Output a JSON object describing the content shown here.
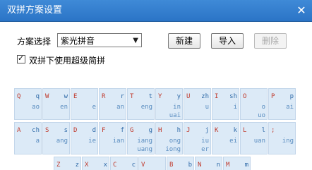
{
  "window": {
    "title": "双拼方案设置",
    "close": "✕"
  },
  "scheme_label": "方案选择",
  "scheme_value": "紫光拼音",
  "buttons": {
    "new": "新建",
    "import": "导入",
    "delete": "删除"
  },
  "checkbox": {
    "label": "双拼下使用超级简拼",
    "checked": true,
    "mark": "✓"
  },
  "keyboard": {
    "row1": [
      {
        "letter": "Q",
        "top": "q",
        "bottom": "ao"
      },
      {
        "letter": "W",
        "top": "w",
        "bottom": "en"
      },
      {
        "letter": "E",
        "top": "",
        "bottom": "e"
      },
      {
        "letter": "R",
        "top": "r",
        "bottom": "an"
      },
      {
        "letter": "T",
        "top": "t",
        "bottom": "eng"
      },
      {
        "letter": "Y",
        "top": "y",
        "bottom": "in\nuai"
      },
      {
        "letter": "U",
        "top": "zh",
        "bottom": "u"
      },
      {
        "letter": "I",
        "top": "sh",
        "bottom": "i"
      },
      {
        "letter": "O",
        "top": "",
        "bottom": "o\nuo"
      },
      {
        "letter": "P",
        "top": "p",
        "bottom": "ai"
      }
    ],
    "row2": [
      {
        "letter": "A",
        "top": "ch",
        "bottom": "a"
      },
      {
        "letter": "S",
        "top": "s",
        "bottom": "ang"
      },
      {
        "letter": "D",
        "top": "d",
        "bottom": "ie"
      },
      {
        "letter": "F",
        "top": "f",
        "bottom": "ian"
      },
      {
        "letter": "G",
        "top": "g",
        "bottom": "iang\nuang"
      },
      {
        "letter": "H",
        "top": "h",
        "bottom": "ong\niong"
      },
      {
        "letter": "J",
        "top": "j",
        "bottom": "iu\ner"
      },
      {
        "letter": "K",
        "top": "k",
        "bottom": "ei"
      },
      {
        "letter": "L",
        "top": "l",
        "bottom": "uan"
      },
      {
        "letter": ";",
        "top": "",
        "bottom": "ing"
      }
    ],
    "row3": [
      {
        "letter": "Z",
        "top": "z"
      },
      {
        "letter": "X",
        "top": "x"
      },
      {
        "letter": "C",
        "top": "c"
      },
      {
        "letter": "V",
        "top": ""
      },
      {
        "letter": "B",
        "top": "b"
      },
      {
        "letter": "N",
        "top": "n"
      },
      {
        "letter": "M",
        "top": "m"
      }
    ]
  }
}
